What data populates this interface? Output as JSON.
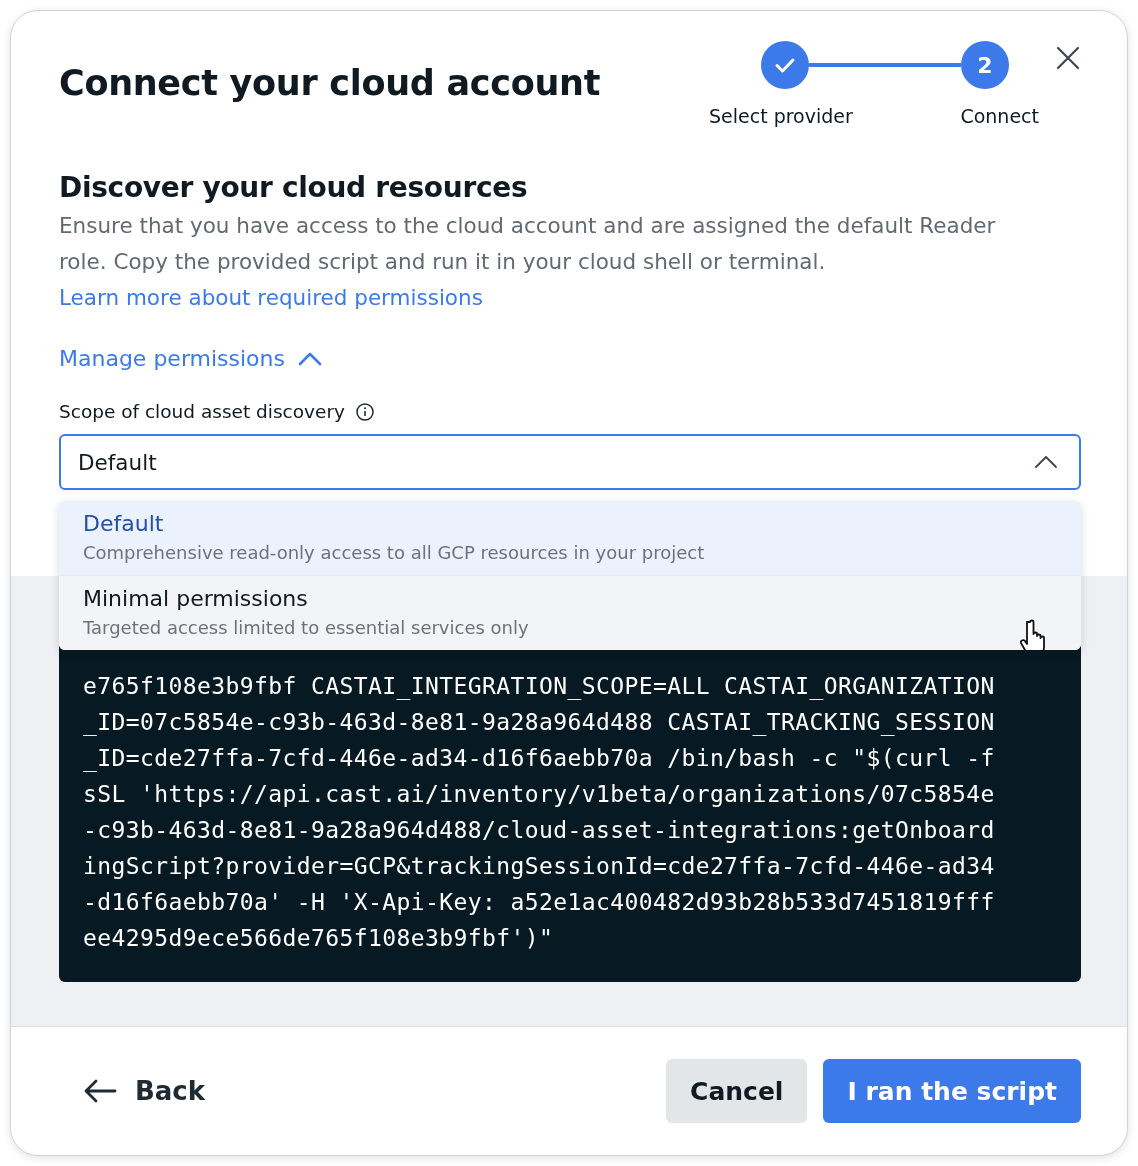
{
  "dialog": {
    "title": "Connect your cloud account"
  },
  "steps": [
    {
      "label": "Select provider",
      "kind": "done"
    },
    {
      "label": "Connect",
      "kind": "current",
      "number": "2"
    }
  ],
  "section": {
    "heading": "Discover your cloud resources",
    "description": "Ensure that you have access to the cloud account and are assigned the default Reader role. Copy the provided script and run it in your cloud shell or terminal.",
    "link": "Learn more about required permissions"
  },
  "manage_permissions": {
    "label": "Manage permissions",
    "expanded": true
  },
  "scope_field": {
    "label": "Scope of cloud asset discovery",
    "value": "Default",
    "open": true
  },
  "scope_options": [
    {
      "title": "Default",
      "description": "Comprehensive read-only access to all GCP resources in your project",
      "selected": true,
      "hovered": false
    },
    {
      "title": "Minimal permissions",
      "description": "Targeted access limited to essential services only",
      "selected": false,
      "hovered": true
    }
  ],
  "script_lines": [
    "e765f108e3b9fbf CASTAI_INTEGRATION_SCOPE=ALL CASTAI_ORGANIZATION",
    "_ID=07c5854e-c93b-463d-8e81-9a28a964d488 CASTAI_TRACKING_SESSION",
    "_ID=cde27ffa-7cfd-446e-ad34-d16f6aebb70a /bin/bash -c \"$(curl -f",
    "sSL 'https://api.cast.ai/inventory/v1beta/organizations/07c5854e",
    "-c93b-463d-8e81-9a28a964d488/cloud-asset-integrations:getOnboard",
    "ingScript?provider=GCP&trackingSessionId=cde27ffa-7cfd-446e-ad34",
    "-d16f6aebb70a' -H 'X-Api-Key: a52e1ac400482d93b28b533d7451819fff",
    "ee4295d9ece566de765f108e3b9fbf')\""
  ],
  "footer": {
    "back": "Back",
    "cancel": "Cancel",
    "confirm": "I ran the script"
  }
}
